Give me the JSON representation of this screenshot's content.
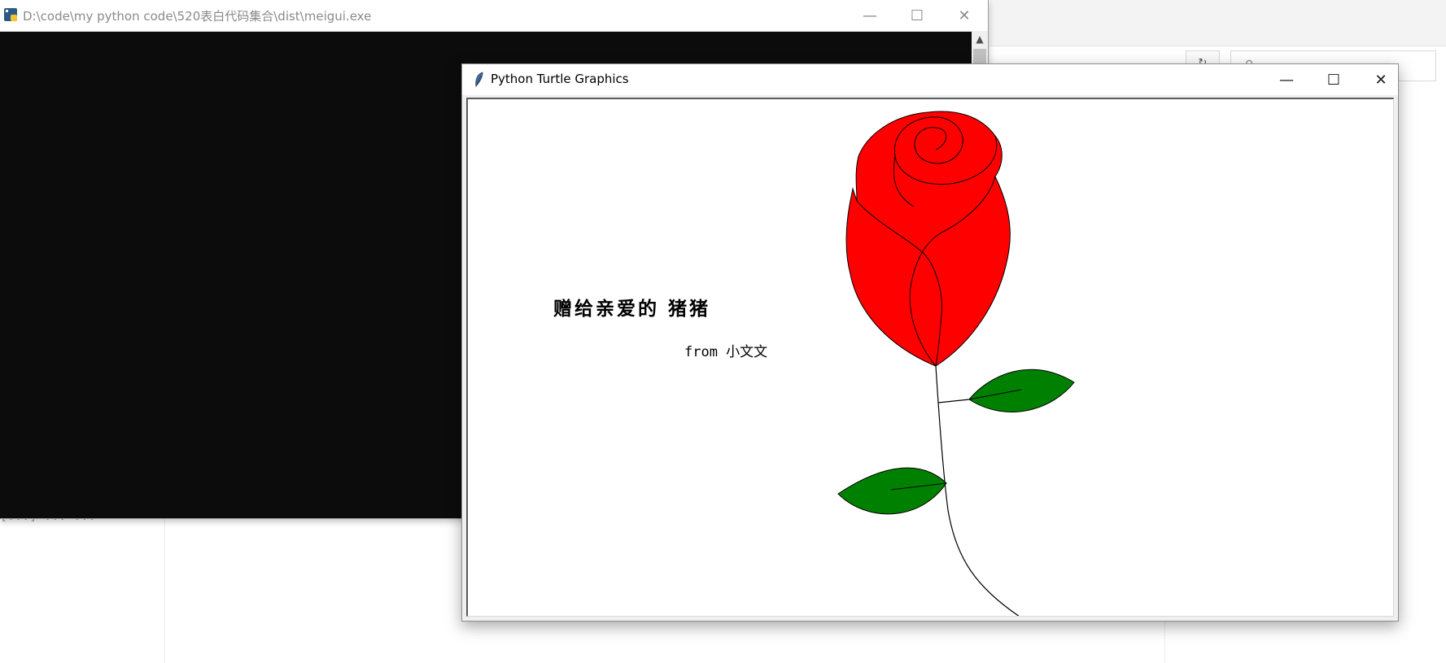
{
  "console_window": {
    "title": "D:\\code\\my python code\\520表白代码集合\\dist\\meigui.exe",
    "background_color": "#0c0c0c",
    "buttons": {
      "minimize": "—",
      "maximize": "☐",
      "close": "✕"
    },
    "scrollbar_up_arrow": "▲"
  },
  "turtle_window": {
    "title": "Python Turtle Graphics",
    "icon": "feather-icon",
    "buttons": {
      "minimize": "—",
      "maximize": "☐",
      "close": "✕"
    },
    "canvas": {
      "message_line1": "赠给亲爱的 猪猪",
      "message_line2": "from 小文文",
      "colors": {
        "flower": "#ff0000",
        "leaves": "#008000",
        "outline": "#000000"
      }
    }
  },
  "background": {
    "dropdown_glyph": "↻",
    "search_icon": "search-icon",
    "terminal_text": "[...] ... ..."
  }
}
